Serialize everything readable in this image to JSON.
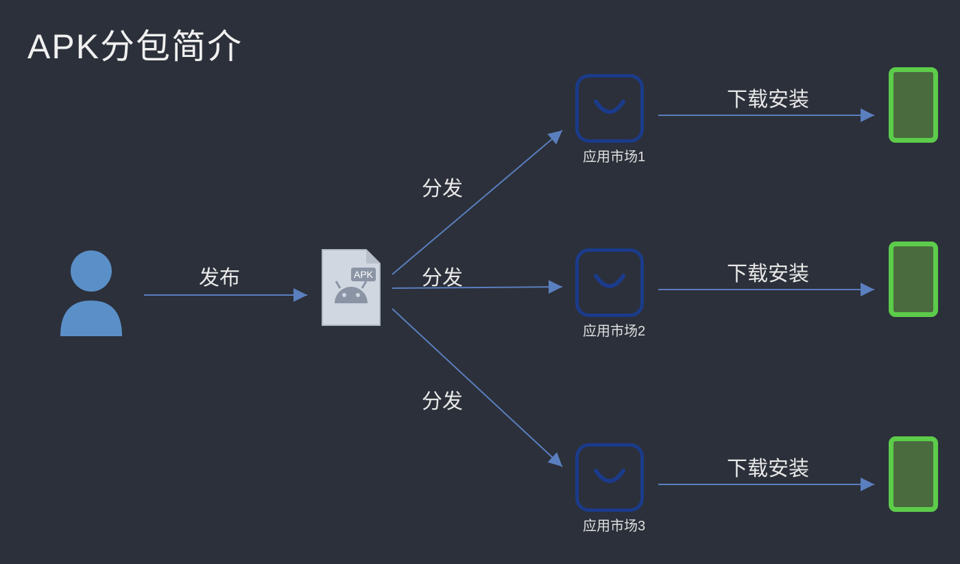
{
  "title": "APK分包简介",
  "labels": {
    "publish": "发布",
    "distribute": "分发",
    "download_install": "下载安装",
    "apk_badge": "APK"
  },
  "stores": [
    {
      "label": "应用市场1"
    },
    {
      "label": "应用市场2"
    },
    {
      "label": "应用市场3"
    }
  ],
  "colors": {
    "arrow": "#5a7fbf",
    "store_border": "#1b3b8a",
    "phone_border": "#5ccc4a",
    "user": "#5a8fc8"
  }
}
